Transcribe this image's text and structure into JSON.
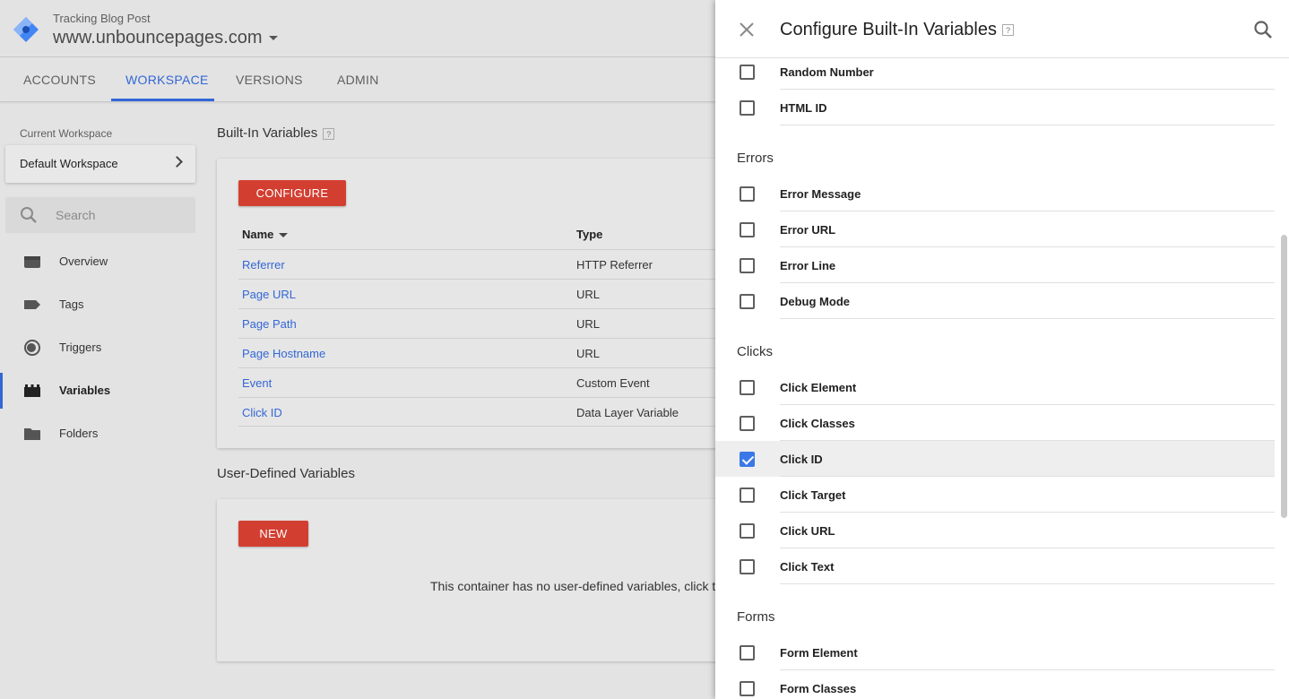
{
  "header": {
    "container_subtitle": "Tracking Blog Post",
    "container_name": "www.unbouncepages.com"
  },
  "nav": {
    "tabs": [
      {
        "label": "ACCOUNTS"
      },
      {
        "label": "WORKSPACE"
      },
      {
        "label": "VERSIONS"
      },
      {
        "label": "ADMIN"
      }
    ],
    "active_tab": "WORKSPACE"
  },
  "sidebar": {
    "workspace_label": "Current Workspace",
    "workspace_name": "Default Workspace",
    "search_placeholder": "Search",
    "items": [
      {
        "label": "Overview",
        "icon": "overview-icon"
      },
      {
        "label": "Tags",
        "icon": "tag-icon"
      },
      {
        "label": "Triggers",
        "icon": "trigger-icon"
      },
      {
        "label": "Variables",
        "icon": "variables-icon"
      },
      {
        "label": "Folders",
        "icon": "folder-icon"
      }
    ],
    "active_item": "Variables"
  },
  "builtin": {
    "title": "Built-In Variables",
    "help": "?",
    "configure_label": "CONFIGURE",
    "col_name": "Name",
    "col_type": "Type",
    "rows": [
      {
        "name": "Referrer",
        "type": "HTTP Referrer"
      },
      {
        "name": "Page URL",
        "type": "URL"
      },
      {
        "name": "Page Path",
        "type": "URL"
      },
      {
        "name": "Page Hostname",
        "type": "URL"
      },
      {
        "name": "Event",
        "type": "Custom Event"
      },
      {
        "name": "Click ID",
        "type": "Data Layer Variable"
      }
    ]
  },
  "userdefined": {
    "title": "User-Defined Variables",
    "new_label": "NEW",
    "empty_message": "This container has no user-defined variables, click t"
  },
  "panel": {
    "title": "Configure Built-In Variables",
    "help": "?",
    "top_options": [
      {
        "label": "Random Number",
        "checked": false
      },
      {
        "label": "HTML ID",
        "checked": false
      }
    ],
    "groups": [
      {
        "title": "Errors",
        "options": [
          {
            "label": "Error Message",
            "checked": false
          },
          {
            "label": "Error URL",
            "checked": false
          },
          {
            "label": "Error Line",
            "checked": false
          },
          {
            "label": "Debug Mode",
            "checked": false
          }
        ]
      },
      {
        "title": "Clicks",
        "options": [
          {
            "label": "Click Element",
            "checked": false
          },
          {
            "label": "Click Classes",
            "checked": false
          },
          {
            "label": "Click ID",
            "checked": true
          },
          {
            "label": "Click Target",
            "checked": false
          },
          {
            "label": "Click URL",
            "checked": false
          },
          {
            "label": "Click Text",
            "checked": false
          }
        ]
      },
      {
        "title": "Forms",
        "options": [
          {
            "label": "Form Element",
            "checked": false
          },
          {
            "label": "Form Classes",
            "checked": false
          }
        ]
      }
    ]
  },
  "colors": {
    "accent_blue": "#3367d6",
    "button_red": "#d23f31",
    "checkbox_blue": "#3b78e7"
  }
}
